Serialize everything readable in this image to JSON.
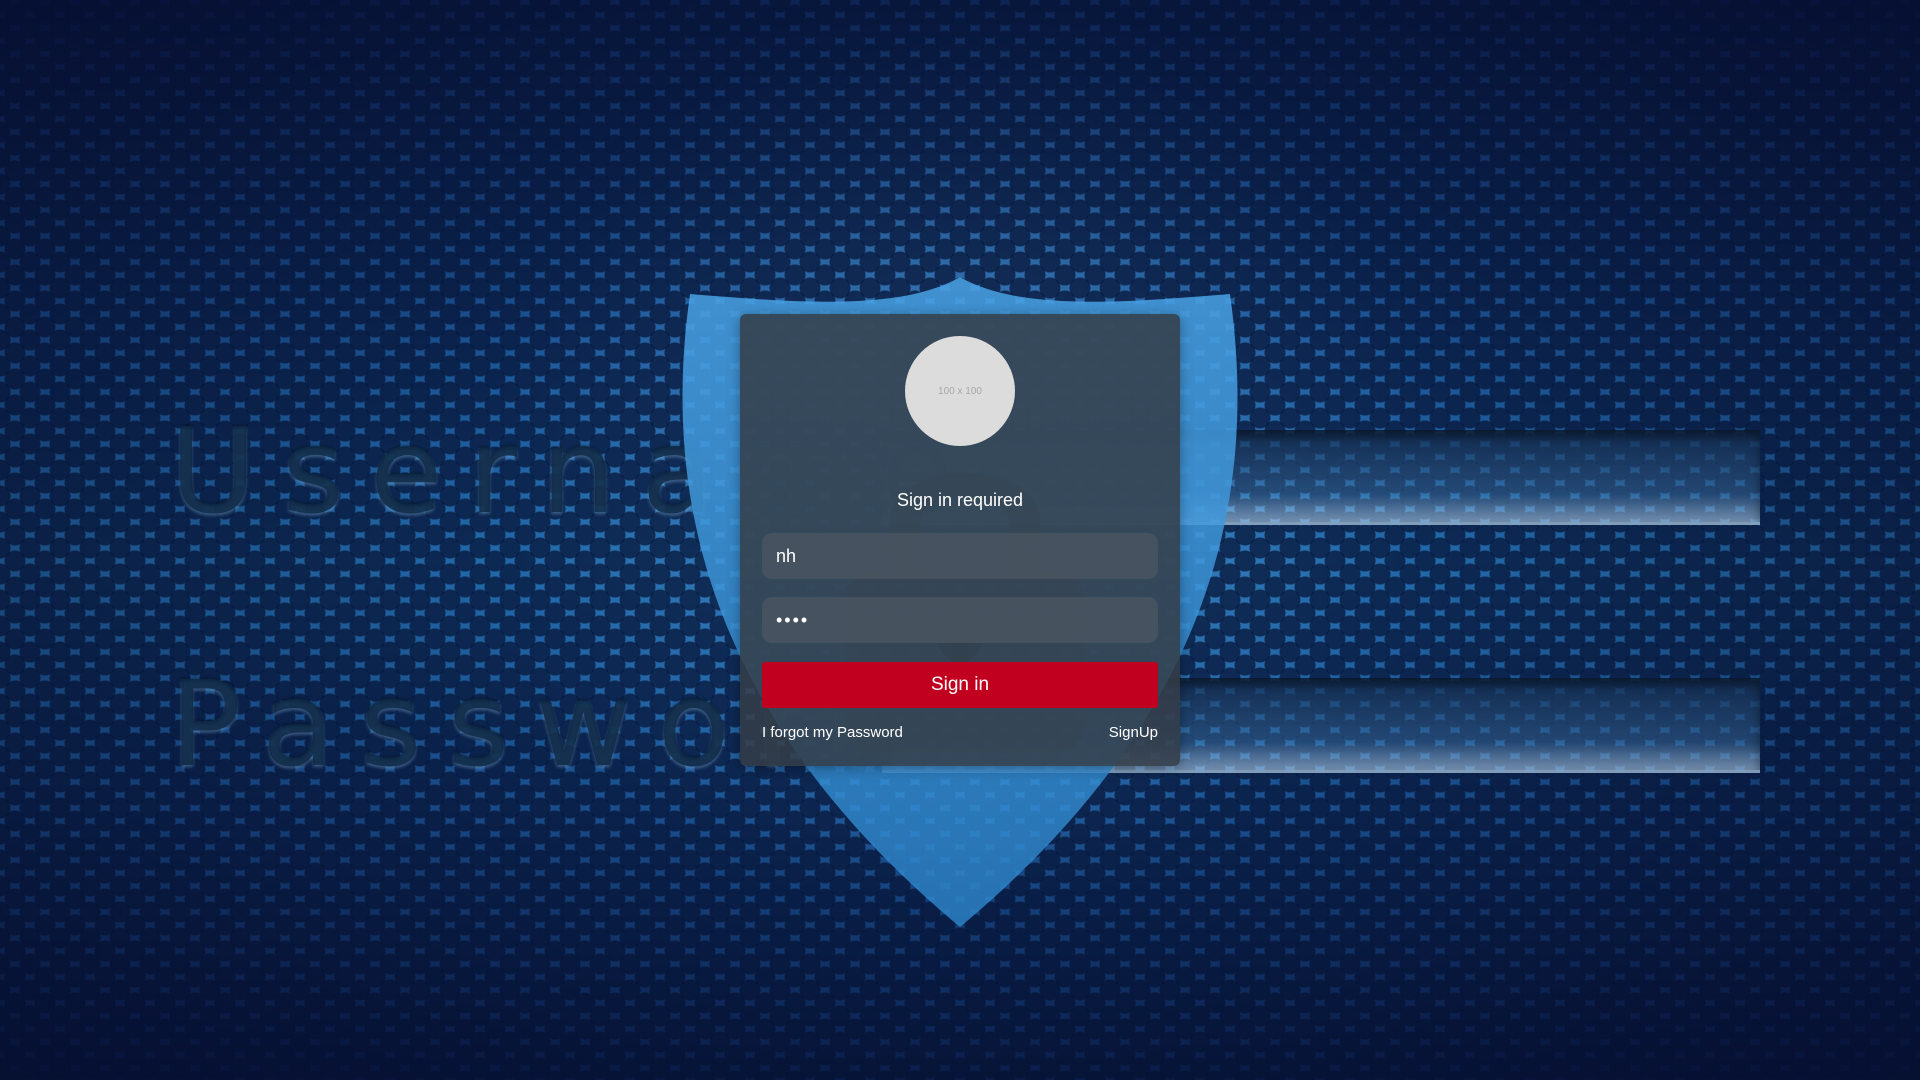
{
  "background": {
    "username_word": "Username",
    "password_word": "Password"
  },
  "login": {
    "avatar_placeholder": "100 x 100",
    "title": "Sign in required",
    "username_value": "nh",
    "password_value": "••••",
    "submit_label": "Sign in",
    "forgot_label": "I forgot my Password",
    "signup_label": "SignUp"
  },
  "colors": {
    "card": "#343e48",
    "field": "#485460",
    "primary_button": "#c1001f",
    "avatar": "#dcdcdc",
    "background_blue": "#236aa8"
  },
  "icons": {
    "shield": "shield-icon",
    "lock": "lock-icon"
  }
}
